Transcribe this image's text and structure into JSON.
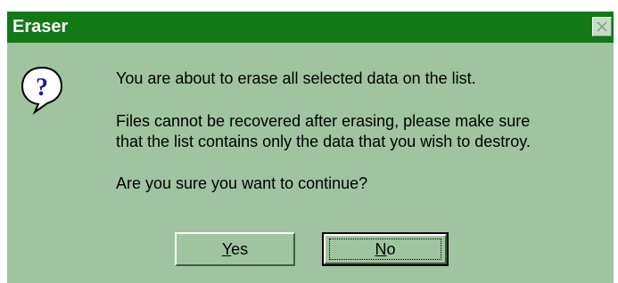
{
  "window": {
    "title": "Eraser"
  },
  "dialog": {
    "icon": "question-icon",
    "message_line1": "You are about to erase all selected data on the list.",
    "message_line2": "Files cannot be recovered after erasing, please make sure",
    "message_line3": "that the list contains only the data that you wish to destroy.",
    "message_line4": "Are you sure you want to continue?"
  },
  "buttons": {
    "yes_accel": "Y",
    "yes_rest": "es",
    "no_accel": "N",
    "no_rest": "o"
  },
  "colors": {
    "title_bar": "#117a17",
    "dialog_background": "#9fc49f"
  }
}
